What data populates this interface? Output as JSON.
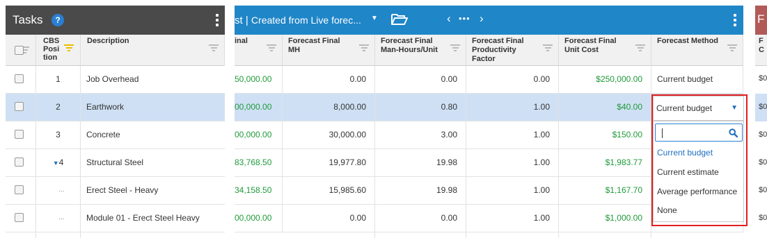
{
  "left_panel": {
    "title": "Tasks",
    "help_icon": "?",
    "headers": {
      "cbs_position": "CBS Posi tion",
      "description": "Description"
    },
    "rows": [
      {
        "cbs": "1",
        "description": "Job Overhead",
        "expand": ""
      },
      {
        "cbs": "2",
        "description": "Earthwork",
        "expand": ""
      },
      {
        "cbs": "3",
        "description": "Concrete",
        "expand": ""
      },
      {
        "cbs": "4",
        "description": "Structural Steel",
        "expand": "▼"
      },
      {
        "cbs": "...",
        "description": "Erect Steel - Heavy",
        "expand": ""
      },
      {
        "cbs": "...",
        "description": "Module 01 - Erect Steel Heavy",
        "expand": ""
      }
    ]
  },
  "main_panel": {
    "view_title": "st",
    "separator": "|",
    "view_subtitle": "Created from Live forec...",
    "nav_prev": "‹",
    "nav_dots": "•••",
    "nav_next": "›",
    "headers": [
      "inal",
      "Forecast Final MH",
      "Forecast Final Man-Hours/Unit",
      "Forecast Final Productivity Factor",
      "Forecast Final Unit Cost",
      "Forecast Method"
    ],
    "rows": [
      {
        "final": "50,000.00",
        "mh": "0.00",
        "mh_unit": "0.00",
        "prod": "0.00",
        "unit_cost": "$250,000.00",
        "method": "Current budget"
      },
      {
        "final": "00,000.00",
        "mh": "8,000.00",
        "mh_unit": "0.80",
        "prod": "1.00",
        "unit_cost": "$40.00",
        "method": "Current budget"
      },
      {
        "final": "00,000.00",
        "mh": "30,000.00",
        "mh_unit": "3.00",
        "prod": "1.00",
        "unit_cost": "$150.00",
        "method": ""
      },
      {
        "final": "83,768.50",
        "mh": "19,977.80",
        "mh_unit": "19.98",
        "prod": "1.00",
        "unit_cost": "$1,983.77",
        "method": ""
      },
      {
        "final": "34,158.50",
        "mh": "15,985.60",
        "mh_unit": "19.98",
        "prod": "1.00",
        "unit_cost": "$1,167.70",
        "method": ""
      },
      {
        "final": "00,000.00",
        "mh": "0.00",
        "mh_unit": "0.00",
        "prod": "1.00",
        "unit_cost": "$1,000.00",
        "method": ""
      }
    ]
  },
  "dropdown": {
    "selected": "Current budget",
    "search_value": "",
    "options": [
      "Current budget",
      "Current estimate",
      "Average performance",
      "None"
    ],
    "highlight_color": "#e21f1f"
  },
  "right_panel": {
    "title": "F",
    "header_fragment": "F C",
    "row_values": [
      "$0",
      "$0",
      "$0",
      "$0",
      "$0",
      "$0"
    ]
  },
  "colors": {
    "left_header": "#4a4a4a",
    "main_header": "#1f86c8",
    "right_header": "#b15a57",
    "selected_row": "#cfe0f4",
    "money_green": "#1f9a3a"
  }
}
